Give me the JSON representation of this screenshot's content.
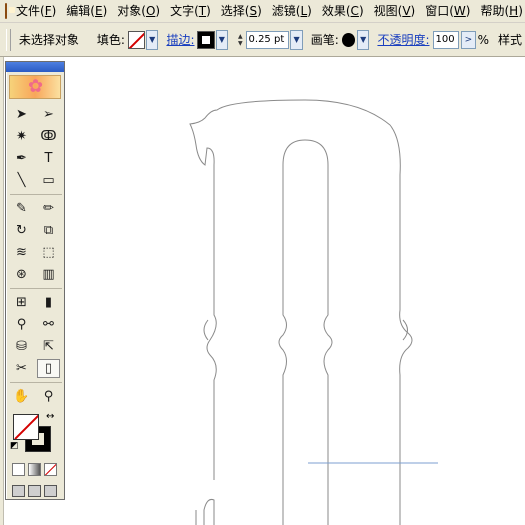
{
  "menubar": {
    "items": [
      {
        "label": "文件(",
        "key": "F",
        "suffix": ")"
      },
      {
        "label": "编辑(",
        "key": "E",
        "suffix": ")"
      },
      {
        "label": "对象(",
        "key": "O",
        "suffix": ")"
      },
      {
        "label": "文字(",
        "key": "T",
        "suffix": ")"
      },
      {
        "label": "选择(",
        "key": "S",
        "suffix": ")"
      },
      {
        "label": "滤镜(",
        "key": "L",
        "suffix": ")"
      },
      {
        "label": "效果(",
        "key": "C",
        "suffix": ")"
      },
      {
        "label": "视图(",
        "key": "V",
        "suffix": ")"
      },
      {
        "label": "窗口(",
        "key": "W",
        "suffix": ")"
      },
      {
        "label": "帮助(",
        "key": "H",
        "suffix": ")"
      }
    ]
  },
  "control": {
    "selection_status": "未选择对象",
    "fill_label": "填色:",
    "stroke_label": "描边:",
    "stroke_weight": "0.25 pt",
    "brush_label": "画笔:",
    "opacity_label": "不透明度:",
    "opacity_value": "100",
    "opacity_unit": "%",
    "style_label": "样式"
  },
  "toolbox": {
    "tools": [
      {
        "name": "selection-tool",
        "glyph": "➤"
      },
      {
        "name": "direct-selection-tool",
        "glyph": "➢"
      },
      {
        "name": "magic-wand-tool",
        "glyph": "✷"
      },
      {
        "name": "lasso-tool",
        "glyph": "ↂ"
      },
      {
        "name": "pen-tool",
        "glyph": "✒"
      },
      {
        "name": "type-tool",
        "glyph": "T"
      },
      {
        "name": "line-tool",
        "glyph": "╲"
      },
      {
        "name": "rectangle-tool",
        "glyph": "▭"
      },
      {
        "name": "paintbrush-tool",
        "glyph": "✎"
      },
      {
        "name": "pencil-tool",
        "glyph": "✏"
      },
      {
        "name": "rotate-tool",
        "glyph": "↻"
      },
      {
        "name": "scale-tool",
        "glyph": "⧉"
      },
      {
        "name": "warp-tool",
        "glyph": "≋"
      },
      {
        "name": "free-transform-tool",
        "glyph": "⬚"
      },
      {
        "name": "symbol-sprayer-tool",
        "glyph": "⊛"
      },
      {
        "name": "column-graph-tool",
        "glyph": "▥"
      },
      {
        "name": "mesh-tool",
        "glyph": "⊞"
      },
      {
        "name": "gradient-tool",
        "glyph": "▮"
      },
      {
        "name": "eyedropper-tool",
        "glyph": "⚲"
      },
      {
        "name": "blend-tool",
        "glyph": "⚯"
      },
      {
        "name": "live-paint-bucket-tool",
        "glyph": "⛁"
      },
      {
        "name": "live-paint-selection-tool",
        "glyph": "⇱"
      },
      {
        "name": "slice-tool",
        "glyph": "✂"
      },
      {
        "name": "eraser-tool",
        "glyph": "▯"
      },
      {
        "name": "hand-tool",
        "glyph": "✋"
      },
      {
        "name": "zoom-tool",
        "glyph": "⚲"
      }
    ]
  }
}
